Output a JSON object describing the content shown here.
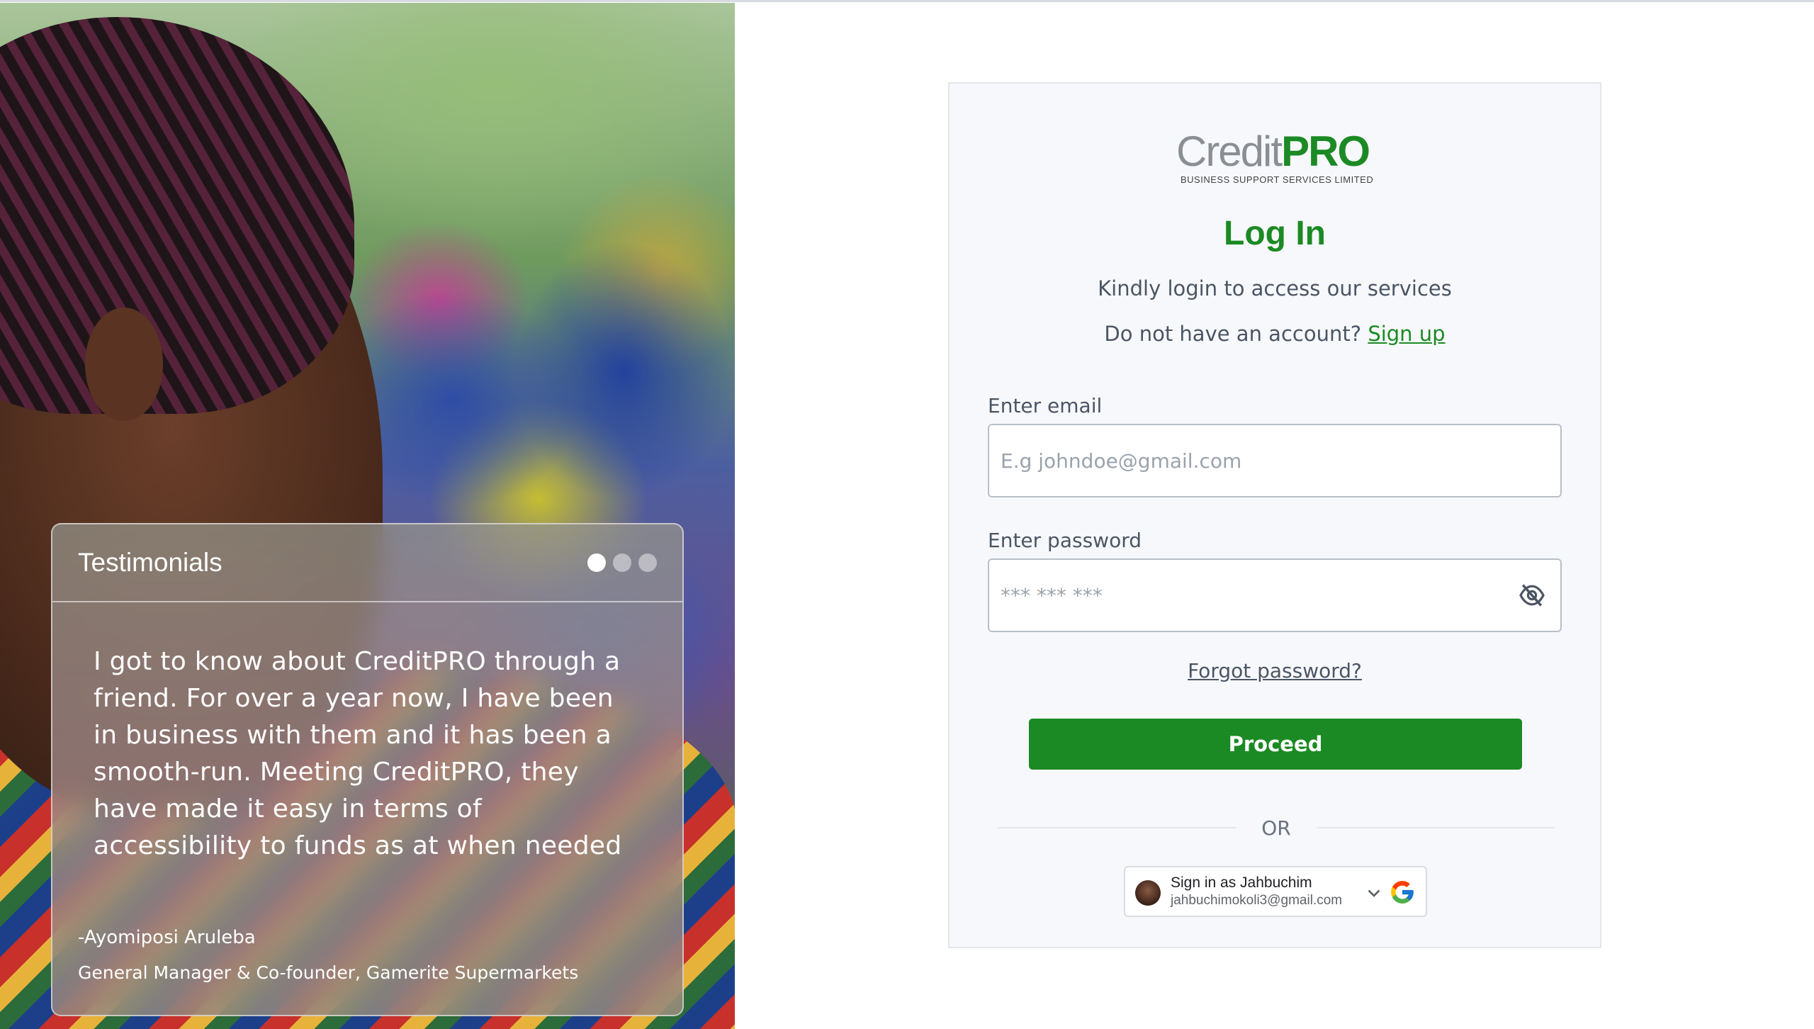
{
  "hero": {
    "testimonials": {
      "title": "Testimonials",
      "quote": "I got to know about CreditPRO through a friend. For over a year now, I have been in business with them and it has been a smooth-run. Meeting CreditPRO, they have made it easy in terms of accessibility to funds as at when needed",
      "author": "-Ayomiposi Aruleba",
      "role": "General Manager & Co-founder, Gamerite Supermarkets",
      "active_dot": 1,
      "dot_count": 3
    }
  },
  "logo": {
    "word_credit": "Credit",
    "word_pro": "PRO",
    "tagline": "BUSINESS SUPPORT SERVICES LIMITED"
  },
  "login": {
    "title": "Log In",
    "subtitle": "Kindly login to access our services",
    "signup_prompt": "Do not have an account?",
    "signup_link": "Sign up",
    "email_label": "Enter email",
    "email_placeholder": "E.g johndoe@gmail.com",
    "email_value": "",
    "password_label": "Enter password",
    "password_placeholder": "*** *** ***",
    "password_value": "",
    "forgot_link": "Forgot password?",
    "proceed_label": "Proceed",
    "or_text": "OR"
  },
  "google_signin": {
    "name_line": "Sign in as Jahbuchim",
    "email": "jahbuchimokoli3@gmail.com"
  },
  "colors": {
    "brand_green": "#1c8a24",
    "card_bg": "#f7f8fb",
    "text_muted": "#4b5563"
  },
  "icons": [
    "eye-off-icon",
    "chevron-down-icon",
    "google-logo-icon",
    "avatar"
  ]
}
